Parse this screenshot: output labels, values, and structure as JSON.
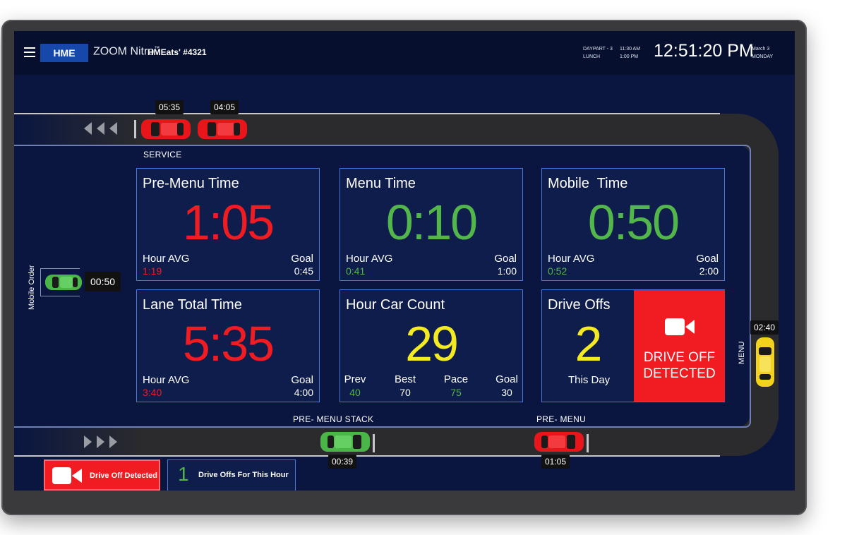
{
  "header": {
    "logo": "HME",
    "product": "ZOOM Nitro",
    "product_tm": "™",
    "store": "HMEats' #4321",
    "daypart_line1": "DAYPART - 3",
    "daypart_line2": "LUNCH",
    "time_range_start": "11:30 AM",
    "time_range_end": "1:00 PM",
    "clock": "12:51:20 PM",
    "date_line1": "March 3",
    "date_line2": "MONDAY"
  },
  "lane": {
    "service_label": "SERVICE",
    "mobile_order_label": "Mobile Order",
    "menu_label": "MENU",
    "pre_menu_stack_label": "PRE- MENU STACK",
    "pre_menu_label": "PRE- MENU",
    "car_times": {
      "service_1": "05:35",
      "service_2": "04:05",
      "mobile": "00:50",
      "menu": "02:40",
      "stack": "00:39",
      "pre_menu": "01:05"
    }
  },
  "tiles": {
    "pre_menu": {
      "title": "Pre-Menu Time",
      "value": "1:05",
      "avg_label": "Hour AVG",
      "avg": "1:19",
      "goal_label": "Goal",
      "goal": "0:45"
    },
    "menu": {
      "title": "Menu Time",
      "value": "0:10",
      "avg_label": "Hour AVG",
      "avg": "0:41",
      "goal_label": "Goal",
      "goal": "1:00"
    },
    "mobile": {
      "title": "Mobile  Time",
      "value": "0:50",
      "avg_label": "Hour AVG",
      "avg": "0:52",
      "goal_label": "Goal",
      "goal": "2:00"
    },
    "lane_total": {
      "title": "Lane Total Time",
      "value": "5:35",
      "avg_label": "Hour AVG",
      "avg": "3:40",
      "goal_label": "Goal",
      "goal": "4:00"
    },
    "car_count": {
      "title": "Hour Car Count",
      "value": "29",
      "stats": [
        {
          "label": "Prev",
          "value": "40"
        },
        {
          "label": "Best",
          "value": "70"
        },
        {
          "label": "Pace",
          "value": "75"
        },
        {
          "label": "Goal",
          "value": "30"
        }
      ]
    },
    "drive_offs": {
      "title": "Drive Offs",
      "value": "2",
      "caption": "This Day",
      "alert_line1": "DRIVE OFF",
      "alert_line2": "DETECTED"
    }
  },
  "footer": {
    "alert_button": "Drive Off Detected",
    "count": "1",
    "count_label": "Drive Offs For This Hour"
  },
  "colors": {
    "alert_red": "#f01c22",
    "good_green": "#52b64a",
    "warn_yellow": "#f3ea22",
    "navy": "#0a1640"
  }
}
